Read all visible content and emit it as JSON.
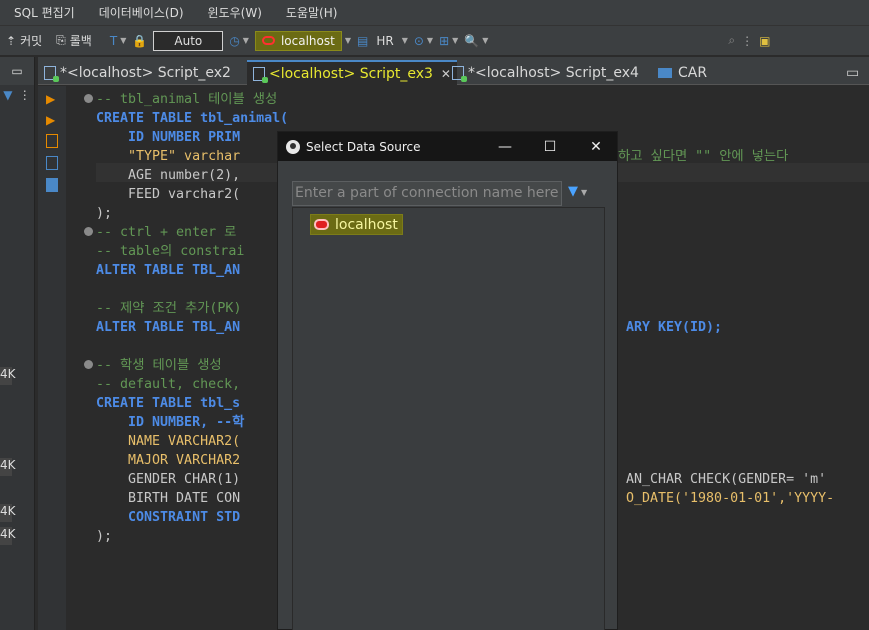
{
  "menu": [
    "SQL 편집기",
    "데이터베이스(D)",
    "윈도우(W)",
    "도움말(H)"
  ],
  "toolbar": {
    "commit": "커밋",
    "rollback": "롤백",
    "auto": "Auto",
    "connection": "localhost",
    "schema": "HR"
  },
  "tabs": [
    {
      "label": "*<localhost> Script_ex2"
    },
    {
      "label": "<localhost> Script_ex3"
    },
    {
      "label": "*<localhost> Script_ex4"
    },
    {
      "label": "CAR"
    }
  ],
  "left_labels": [
    "4K",
    "4K",
    "4K",
    "4K"
  ],
  "code": [
    "-- tbl_animal 테이블 생성",
    "CREATE TABLE tbl_animal(",
    "    ID NUMBER PRIM",
    "    \"TYPE\" varchar",
    "    AGE number(2),",
    "    FEED varchar2(",
    ");",
    "-- ctrl + enter 로",
    "-- table의 constrai",
    "ALTER TABLE TBL_AN",
    "",
    "-- 제약 조건 추가(PK)",
    "ALTER TABLE TBL_AN",
    "",
    "-- 학생 테이블 생성",
    "-- default, check,",
    "CREATE TABLE tbl_s",
    "    ID NUMBER, --학",
    "    NAME VARCHAR2(",
    "    MAJOR VARCHAR2",
    "    GENDER CHAR(1)",
    "    BIRTH DATE CON",
    "    CONSTRAINT STD",
    ");"
  ],
  "code_right": {
    "line3": "하고 싶다면 \"\" 안에 넣는다",
    "line12": "ARY KEY(ID);",
    "line20a": "AN_CHAR CHECK(GENDER= 'm'",
    "line21a": "O_DATE('1980-01-01','YYYY-"
  },
  "dialog": {
    "title": "Select Data Source",
    "search_placeholder": "Enter a part of connection name here",
    "items": [
      {
        "label": "localhost"
      }
    ]
  }
}
